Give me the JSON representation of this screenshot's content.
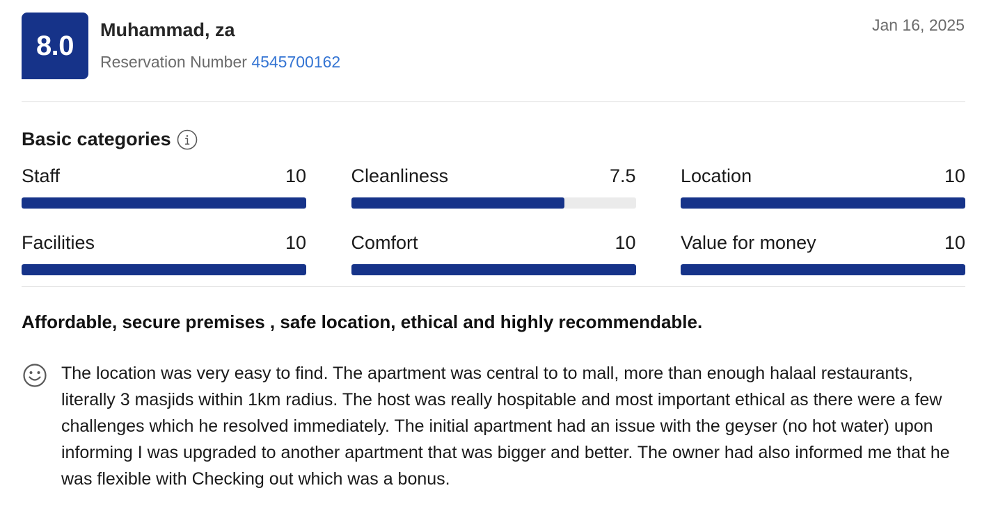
{
  "review": {
    "score": "8.0",
    "reviewer_name": "Muhammad, za",
    "reservation_label": "Reservation Number",
    "reservation_number": "4545700162",
    "date": "Jan 16, 2025"
  },
  "categories": {
    "heading": "Basic categories",
    "info_icon": "info-icon",
    "bar_color": "#163389",
    "track_color": "#ebebeb",
    "max_score": 10,
    "items": [
      {
        "label": "Staff",
        "value": "10",
        "fraction": 1.0
      },
      {
        "label": "Cleanliness",
        "value": "7.5",
        "fraction": 0.75
      },
      {
        "label": "Location",
        "value": "10",
        "fraction": 1.0
      },
      {
        "label": "Facilities",
        "value": "10",
        "fraction": 1.0
      },
      {
        "label": "Comfort",
        "value": "10",
        "fraction": 1.0
      },
      {
        "label": "Value for money",
        "value": "10",
        "fraction": 1.0
      }
    ]
  },
  "feedback": {
    "title": "Affordable, secure premises , safe location, ethical and highly recommendable.",
    "positive_icon": "smiley-face-icon",
    "positive_text": "The location was very easy to find. The apartment was central to to mall, more than enough halaal restaurants, literally 3 masjids within 1km radius. The host was really hospitable and most important ethical as there were a few challenges which he resolved immediately. The initial apartment had an issue with the geyser (no hot water) upon informing I was upgraded to another apartment that was bigger and better. The owner had also informed me that he was flexible with Checking out which was a bonus."
  },
  "colors": {
    "brand": "#163389",
    "link": "#3575d3",
    "muted": "#6b6b6b"
  }
}
